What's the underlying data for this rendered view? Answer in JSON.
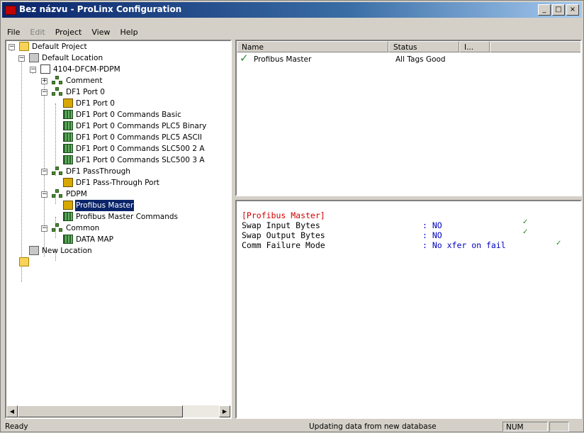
{
  "window": {
    "title": "Bez názvu - ProLinx Configuration",
    "min_glyph": "_",
    "max_glyph": "□",
    "close_glyph": "×"
  },
  "menu": [
    {
      "label": "File",
      "disabled": false
    },
    {
      "label": "Edit",
      "disabled": true
    },
    {
      "label": "Project",
      "disabled": false
    },
    {
      "label": "View",
      "disabled": false
    },
    {
      "label": "Help",
      "disabled": false
    }
  ],
  "tree": {
    "n0": {
      "label": "Default Project",
      "icon": "folder-icon"
    },
    "n1": {
      "label": "Default Location",
      "icon": "folder-gear-icon"
    },
    "n2": {
      "label": "4104-DFCM-PDPM",
      "icon": "module-icon"
    },
    "n3": {
      "label": "Comment",
      "icon": "network-icon"
    },
    "n4": {
      "label": "DF1 Port 0",
      "icon": "network-icon"
    },
    "n5": {
      "label": "DF1 Port 0",
      "icon": "port-icon"
    },
    "n6": {
      "label": "DF1 Port 0 Commands Basic",
      "icon": "grid-icon"
    },
    "n7": {
      "label": "DF1 Port 0 Commands PLC5 Binary",
      "icon": "grid-icon"
    },
    "n8": {
      "label": "DF1 Port 0 Commands PLC5 ASCII",
      "icon": "grid-icon"
    },
    "n9": {
      "label": "DF1 Port 0 Commands SLC500 2 A",
      "icon": "grid-icon"
    },
    "n10": {
      "label": "DF1 Port 0 Commands SLC500 3 A",
      "icon": "grid-icon"
    },
    "n11": {
      "label": "DF1 PassThrough",
      "icon": "network-icon"
    },
    "n12": {
      "label": "DF1 Pass-Through Port",
      "icon": "port-icon"
    },
    "n13": {
      "label": "PDPM",
      "icon": "network-icon"
    },
    "n14": {
      "label": "Profibus Master",
      "icon": "port-icon",
      "selected": true
    },
    "n15": {
      "label": "Profibus Master Commands",
      "icon": "grid-icon"
    },
    "n16": {
      "label": "Common",
      "icon": "network-icon"
    },
    "n17": {
      "label": "DATA MAP",
      "icon": "grid-icon"
    },
    "n18": {
      "label": "New Location",
      "icon": "folder-gear-icon"
    },
    "n19": {
      "label": "",
      "icon": "folder-icon"
    }
  },
  "list": {
    "columns": [
      "Name",
      "Status",
      "I..."
    ],
    "rows": [
      {
        "name": "Profibus Master",
        "status": "All Tags Good",
        "check": "✓"
      }
    ]
  },
  "config": {
    "section": "[Profibus Master]",
    "entries": [
      {
        "key": "Swap Input Bytes",
        "value": ": NO",
        "ok": "✓"
      },
      {
        "key": "Swap Output Bytes",
        "value": ": NO",
        "ok": "✓"
      },
      {
        "key": "Comm Failure Mode",
        "value": ": No xfer on fail",
        "ok": "✓"
      }
    ]
  },
  "status": {
    "left": "Ready",
    "center": "Updating data from new database",
    "num": "NUM"
  }
}
